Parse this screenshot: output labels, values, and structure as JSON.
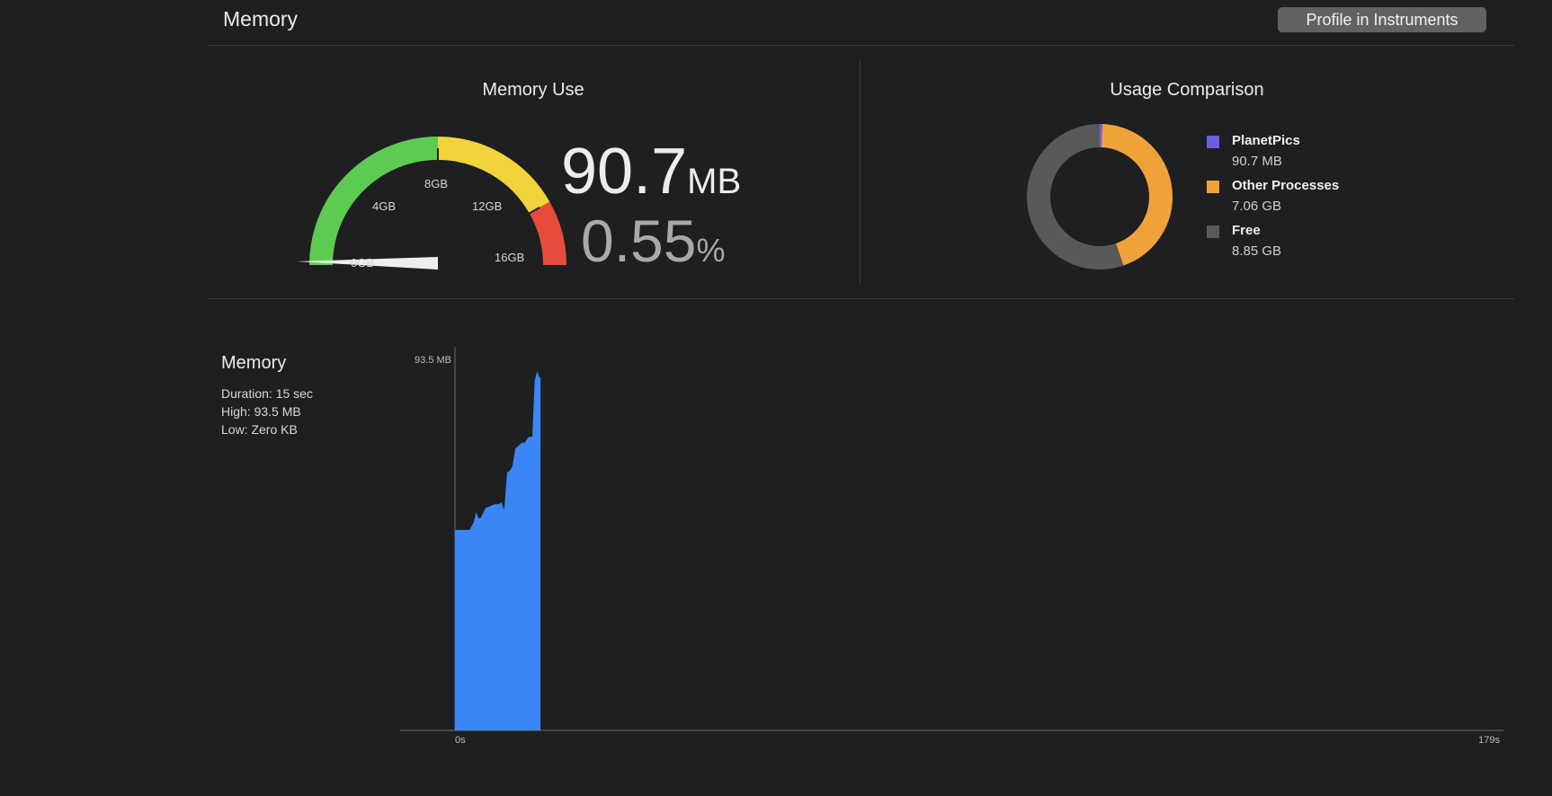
{
  "header": {
    "title": "Memory",
    "profile_button": "Profile in Instruments"
  },
  "memory_use": {
    "heading": "Memory Use",
    "gauge": {
      "labels": [
        "0GB",
        "4GB",
        "8GB",
        "12GB",
        "16GB"
      ],
      "max_gb": 16,
      "value_fraction": 0.0055,
      "colors": {
        "green": "#5dcb52",
        "yellow": "#f3d33b",
        "red": "#e74b3c",
        "needle": "#eeeeee"
      }
    },
    "value_number": "90.7",
    "value_unit": "MB",
    "percent_number": "0.55",
    "percent_unit": "%"
  },
  "usage_comparison": {
    "heading": "Usage Comparison",
    "legend": [
      {
        "name": "PlanetPics",
        "value": "90.7 MB",
        "color": "#6a5fe0",
        "gb": 0.0907
      },
      {
        "name": "Other Processes",
        "value": "7.06 GB",
        "color": "#f0a23a",
        "gb": 7.06
      },
      {
        "name": "Free",
        "value": "8.85 GB",
        "color": "#58595b",
        "gb": 8.85
      }
    ]
  },
  "memory_panel": {
    "title": "Memory",
    "duration": "Duration: 15 sec",
    "high": "High: 93.5 MB",
    "low": "Low: Zero KB"
  },
  "chart_data": {
    "type": "area",
    "color": "#3a86f6",
    "y_max_label": "93.5 MB",
    "x_start_label": "0s",
    "x_end_label": "179s",
    "x_range": [
      0,
      179
    ],
    "y_range": [
      0,
      93.5
    ],
    "x": [
      0,
      0.2,
      2.5,
      3.2,
      3.6,
      4.0,
      4.4,
      5.2,
      6.0,
      6.8,
      7.4,
      7.9,
      8.4,
      8.9,
      9.4,
      9.8,
      10.3,
      10.7,
      11.4,
      11.9,
      12.6,
      13.2,
      13.6,
      14.0,
      14.4,
      14.6
    ],
    "y": [
      50.5,
      50.5,
      50.5,
      52.5,
      55,
      53.5,
      53.5,
      56,
      56.5,
      57,
      57,
      57.5,
      55.5,
      65,
      65.5,
      66.5,
      71,
      71.5,
      72.5,
      72.5,
      74,
      74,
      88,
      90.5,
      89,
      89
    ]
  }
}
